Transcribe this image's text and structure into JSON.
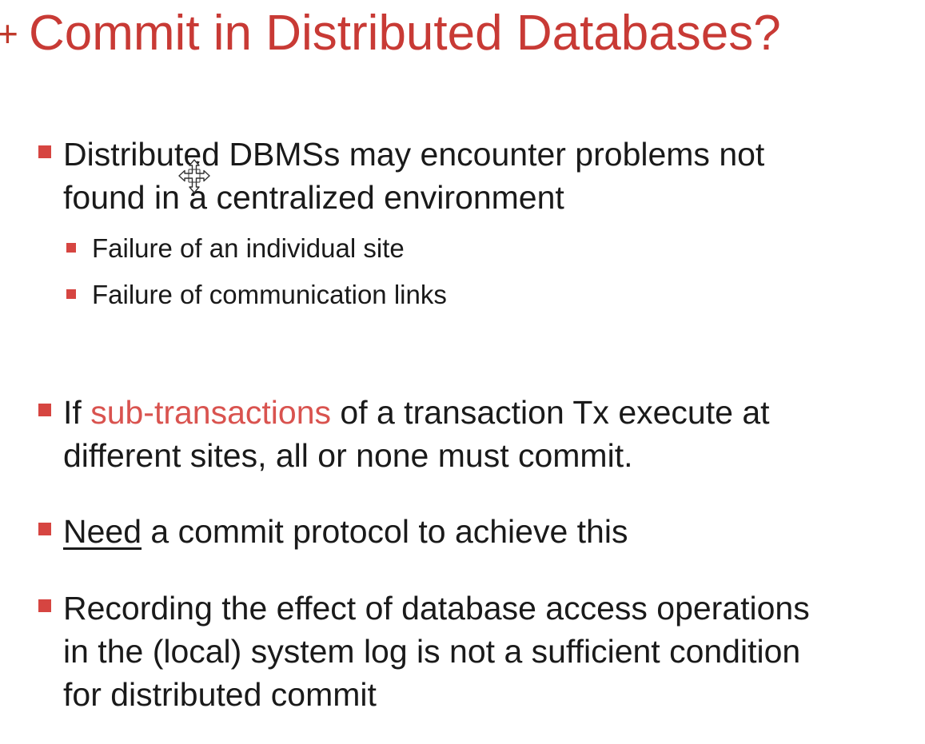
{
  "slide": {
    "title_marker": "+",
    "title": "Commit in Distributed Databases?",
    "bullets": [
      {
        "lines": [
          "Distributed DBMSs may encounter problems not",
          "found in a centralized environment"
        ],
        "sub_bullets": [
          "Failure of an individual site",
          "Failure of communication links"
        ]
      },
      {
        "line1_pre": "If ",
        "line1_highlight": "sub-transactions",
        "line1_post": " of a transaction Tx execute at",
        "line2": "different sites, all or none must commit."
      },
      {
        "underlined_word": "Need",
        "rest": " a commit protocol to achieve this"
      },
      {
        "lines": [
          "Recording the effect of database access operations",
          "in the (local) system log is not a sufficient condition",
          "for distributed commit"
        ]
      }
    ]
  },
  "colors": {
    "title": "#c83a35",
    "bullet_square": "#d64541",
    "highlight_text": "#d9534f",
    "body_text": "#1a1a1a"
  },
  "icons": {
    "cursor": "move-cursor-icon"
  }
}
